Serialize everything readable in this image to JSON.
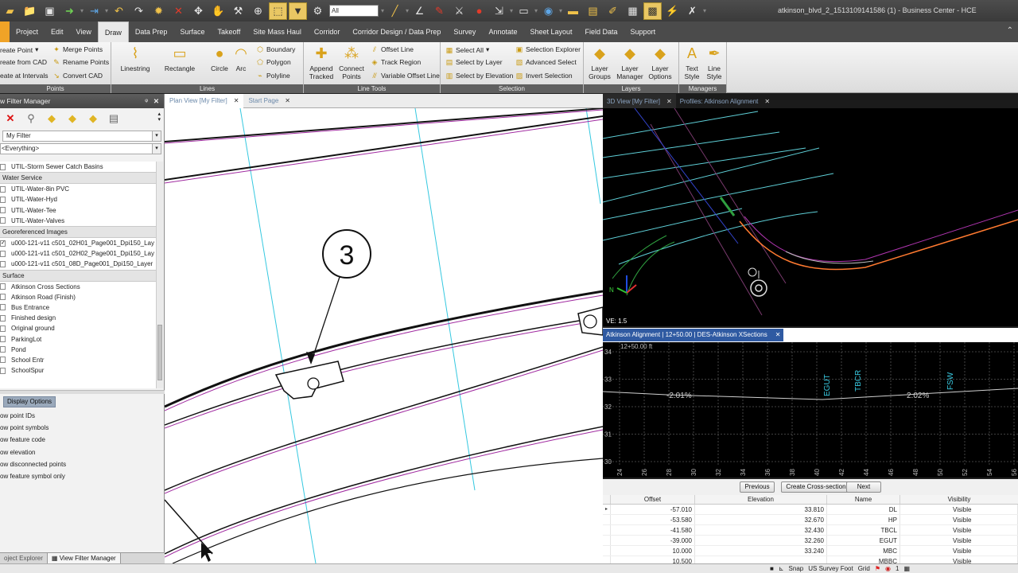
{
  "window": {
    "title": "atkinson_blvd_2_1513109141586 (1) - Business Center - HCE"
  },
  "qat": {
    "filter_value": "All"
  },
  "ribbon_tabs": [
    "Project",
    "Edit",
    "View",
    "Draw",
    "Data Prep",
    "Surface",
    "Takeoff",
    "Site Mass Haul",
    "Corridor",
    "Corridor Design / Data Prep",
    "Survey",
    "Annotate",
    "Sheet Layout",
    "Field Data",
    "Support"
  ],
  "ribbon": {
    "points": {
      "label": "Points",
      "create_point": "reate Point",
      "create_from_cad": "reate from CAD",
      "create_intervals": "eate at Intervals",
      "merge_points": "Merge Points",
      "rename_points": "Rename Points",
      "convert_cad": "Convert CAD"
    },
    "lines": {
      "label": "Lines",
      "linestring": "Linestring",
      "rectangle": "Rectangle",
      "circle": "Circle",
      "arc": "Arc",
      "boundary": "Boundary",
      "polygon": "Polygon",
      "polyline": "Polyline"
    },
    "line_tools": {
      "label": "Line Tools",
      "append": "Append\nTracked",
      "connect": "Connect\nPoints",
      "offset_line": "Offset Line",
      "track_region": "Track Region",
      "variable_offset": "Variable Offset Line"
    },
    "selection": {
      "label": "Selection",
      "select_all": "Select All",
      "select_layer": "Select by Layer",
      "select_elevation": "Select by Elevation",
      "selection_explorer": "Selection Explorer",
      "advanced_select": "Advanced Select",
      "invert_selection": "Invert Selection"
    },
    "layers": {
      "label": "Layers",
      "groups": "Layer\nGroups",
      "manager": "Layer\nManager",
      "options": "Layer\nOptions"
    },
    "managers": {
      "label": "Managers",
      "text_style": "Text\nStyle",
      "line_style": "Line\nStyle"
    }
  },
  "left_panel": {
    "title": "w Filter Manager",
    "filter": "My Filter",
    "scope": "<Everything>",
    "layers": [
      {
        "type": "item",
        "label": "UTIL-Storm Sewer Catch Basins",
        "checked": false
      },
      {
        "type": "head",
        "label": "Water Service"
      },
      {
        "type": "item",
        "label": "UTIL-Water-8in PVC",
        "checked": false
      },
      {
        "type": "item",
        "label": "UTIL-Water-Hyd",
        "checked": false
      },
      {
        "type": "item",
        "label": "UTIL-Water-Tee",
        "checked": false
      },
      {
        "type": "item",
        "label": "UTIL-Water-Valves",
        "checked": false
      },
      {
        "type": "head",
        "label": "Georeferenced Images"
      },
      {
        "type": "item",
        "label": "u000-121-v11 c501_02H01_Page001_Dpi150_Lay",
        "checked": true
      },
      {
        "type": "item",
        "label": "u000-121-v11 c501_02H02_Page001_Dpi150_Lay",
        "checked": false
      },
      {
        "type": "item",
        "label": "u000-121-v11 c501_08D_Page001_Dpi150_Layer",
        "checked": false
      },
      {
        "type": "head",
        "label": "Surface"
      },
      {
        "type": "item",
        "label": "Atkinson Cross Sections",
        "checked": false
      },
      {
        "type": "item",
        "label": "Atkinson Road (Finish)",
        "checked": false
      },
      {
        "type": "item",
        "label": "Bus Entrance",
        "checked": false
      },
      {
        "type": "item",
        "label": "Finished design",
        "checked": false
      },
      {
        "type": "item",
        "label": "Original ground",
        "checked": false
      },
      {
        "type": "item",
        "label": "ParkingLot",
        "checked": false
      },
      {
        "type": "item",
        "label": "Pond",
        "checked": false
      },
      {
        "type": "item",
        "label": "School Entr",
        "checked": false
      },
      {
        "type": "item",
        "label": "SchoolSpur",
        "checked": false
      }
    ],
    "display_options": "Display Options",
    "options": [
      "ow point IDs",
      "ow point symbols",
      "ow feature code",
      "ow elevation",
      "ow disconnected points",
      "ow feature symbol only"
    ],
    "bottom_tabs": [
      "oject Explorer",
      "View Filter Manager"
    ]
  },
  "plan_tabs": [
    "Plan View [My Filter]",
    "Start Page"
  ],
  "plan": {
    "callout": "3"
  },
  "view3d_tabs": [
    "3D View [My Filter]",
    "Profiles: Atkinson Alignment"
  ],
  "view3d": {
    "ve": "VE: 1.5",
    "north": "N"
  },
  "xs_tab": "Atkinson Alignment | 12+50.00 | DES-Atkinson XSections",
  "xs": {
    "station": "12+50.00 ft",
    "y_ticks": [
      "34",
      "33",
      "32",
      "31",
      "30"
    ],
    "x_ticks": [
      "24",
      "26",
      "28",
      "30",
      "32",
      "34",
      "36",
      "38",
      "40",
      "42",
      "44",
      "46",
      "48",
      "50",
      "52",
      "54",
      "56"
    ],
    "slope_left": "-2.01%",
    "slope_right": "2.02%",
    "labels": [
      "EGUT",
      "TBCR",
      "FSW"
    ],
    "prev": "Previous",
    "create": "Create Cross-section",
    "next": "Next"
  },
  "grid": {
    "headers": [
      "Offset",
      "Elevation",
      "Name",
      "Visibility"
    ],
    "rows": [
      [
        "-57.010",
        "33.810",
        "DL",
        "Visible"
      ],
      [
        "-53.580",
        "32.670",
        "HP",
        "Visible"
      ],
      [
        "-41.580",
        "32.430",
        "TBCL",
        "Visible"
      ],
      [
        "-39.000",
        "32.260",
        "EGUT",
        "Visible"
      ],
      [
        "10.000",
        "33.240",
        "MBC",
        "Visible"
      ],
      [
        "10.500",
        "",
        "MBBC",
        "Visible"
      ]
    ]
  },
  "status": {
    "snap": "Snap",
    "units": "US Survey Foot",
    "grid": "Grid",
    "value": "1"
  }
}
